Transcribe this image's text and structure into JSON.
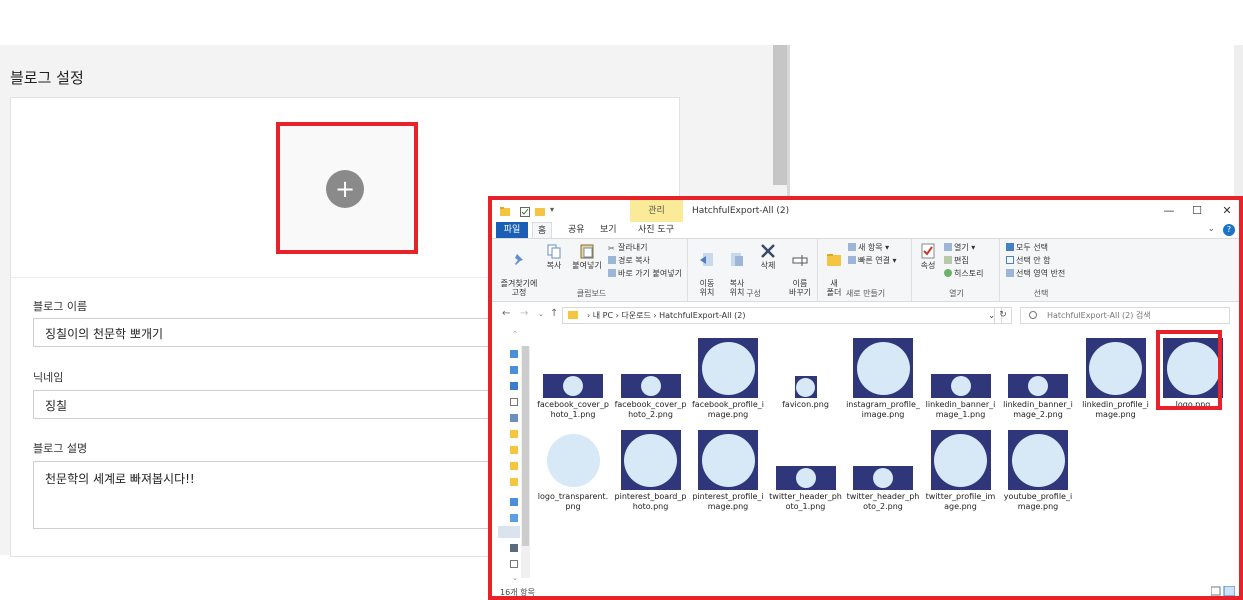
{
  "blog": {
    "page_title": "블로그 설정",
    "name_label": "블로그 이름",
    "name_value": "징칠이의 천문학 뽀개기",
    "nickname_label": "닉네임",
    "nickname_value": "징칠",
    "desc_label": "블로그 설명",
    "desc_value": "천문학의 세계로 빠져봅시다!!",
    "upload_icon": "plus-icon"
  },
  "explorer": {
    "tab_manage": "관리",
    "window_title": "HatchfulExport-All (2)",
    "tabs": {
      "file": "파일",
      "home": "홈",
      "share": "공유",
      "view": "보기",
      "picture_tools": "사진 도구"
    },
    "ribbon": {
      "pin": "즐겨찾기에\n고정",
      "copy": "복사",
      "paste": "붙여넣기",
      "cut": "잘라내기",
      "copy_path": "경로 복사",
      "paste_shortcut": "바로 가기 붙여넣기",
      "clipboard_group": "클립보드",
      "move_to": "이동\n위치",
      "copy_to": "복사\n위치",
      "delete": "삭제",
      "rename": "이름\n바꾸기",
      "organize_group": "구성",
      "new_folder": "새\n폴더",
      "new_item": "새 항목",
      "easy_access": "빠른 연결",
      "new_group": "새로 만들기",
      "properties": "속성",
      "open": "열기",
      "edit": "편집",
      "history": "히스토리",
      "open_group": "열기",
      "select_all": "모두 선택",
      "select_none": "선택 안 함",
      "invert_selection": "선택 영역 반전",
      "select_group": "선택"
    },
    "address": {
      "path_pc": "내 PC",
      "path_downloads": "다운로드",
      "path_folder": "HatchfulExport-All (2)",
      "search_placeholder": "HatchfulExport-All (2) 검색"
    },
    "files": [
      {
        "name": "facebook_cover_photo_1.png",
        "kind": "banner"
      },
      {
        "name": "facebook_cover_photo_2.png",
        "kind": "banner"
      },
      {
        "name": "facebook_profile_image.png",
        "kind": "square"
      },
      {
        "name": "favicon.png",
        "kind": "tiny"
      },
      {
        "name": "instagram_profile_image.png",
        "kind": "square"
      },
      {
        "name": "linkedin_banner_image_1.png",
        "kind": "banner"
      },
      {
        "name": "linkedin_banner_image_2.png",
        "kind": "banner"
      },
      {
        "name": "linkedin_profile_image.png",
        "kind": "square"
      },
      {
        "name": "logo.png",
        "kind": "square"
      },
      {
        "name": "logo_transparent.png",
        "kind": "light"
      },
      {
        "name": "pinterest_board_photo.png",
        "kind": "square"
      },
      {
        "name": "pinterest_profile_image.png",
        "kind": "square"
      },
      {
        "name": "twitter_header_photo_1.png",
        "kind": "banner"
      },
      {
        "name": "twitter_header_photo_2.png",
        "kind": "banner"
      },
      {
        "name": "twitter_profile_image.png",
        "kind": "square"
      },
      {
        "name": "youtube_profile_image.png",
        "kind": "square"
      }
    ],
    "status_text": "16개 항목",
    "colors": {
      "highlight": "#e8222b",
      "thumb_navy": "#2f3679",
      "thumb_circle": "#d7e8f6",
      "ribbon_file_tab": "#1a5fb4",
      "manage_tab": "#fbeb98"
    }
  }
}
